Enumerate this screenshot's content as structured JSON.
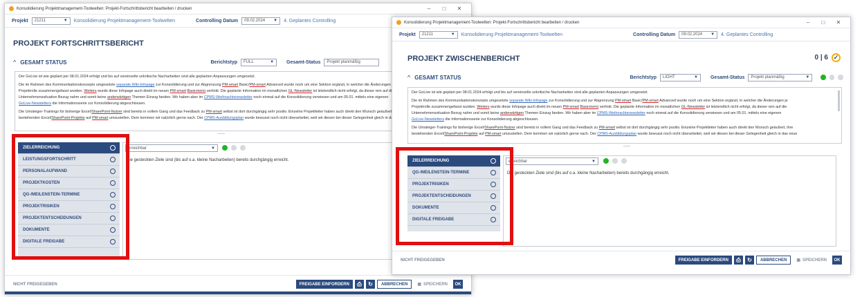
{
  "window_title": "Konsolidierung Projektmanagement-Toolwelten: Projekt-Fortschrittsbericht bearbeiten / drucken",
  "window_title2": "Konsolidierung Projektmanagement-Toolwelten: Projekt-Fortschrittsbericht bearbeiten / drucken",
  "window_controls": {
    "min": "–",
    "max": "□",
    "close": "✕"
  },
  "project": {
    "label": "Projekt",
    "id": "21211",
    "name": "Konsolidierung Projektmanagement-Toolwelten",
    "controlling_label": "Controlling Datum",
    "controlling_date": "09.02.2024",
    "controlling_name": "4. Geplantes Controlling"
  },
  "win1": {
    "report_title": "PROJEKT FORTSCHRITTSBERICHT",
    "section_title": "GESAMT STATUS",
    "berichtstyp_label": "Berichtstyp",
    "berichtstyp_value": "FULL",
    "gesamtstatus_label": "Gesamt-Status",
    "gesamtstatus_value": "Projekt planmäßig",
    "status_select": "erreichbar",
    "status_text": "Die gesteckten Ziele sind (bis auf o.a. kleine Nacharbeiten) bereits durchgängig erreicht.",
    "nav": [
      "ZIELERREICHUNG",
      "LEISTUNGSFORTSCHRITT",
      "PERSONALAUFWAND",
      "PROJEKTKOSTEN",
      "QG-/MEILENSTEIN-TERMINE",
      "PROJEKTRISIKEN",
      "PROJEKTENTSCHEIDUNGEN",
      "DOKUMENTE",
      "DIGITALE FREIGABE"
    ]
  },
  "win2": {
    "report_title": "PROJEKT ZWISCHENBERICHT",
    "score": "0 | 6",
    "section_title": "GESAMT STATUS",
    "berichtstyp_label": "Berichtstyp",
    "berichtstyp_value": "LIGHT",
    "gesamtstatus_label": "Gesamt-Status",
    "gesamtstatus_value": "Projekt planmäßig",
    "status_select": "erreichbar",
    "status_text": "Die gesteckten Ziele sind (bis auf o.a. kleine Nacharbeiten) bereits durchgängig erreicht.",
    "nav": [
      "ZIELERREICHUNG",
      "QG-/MEILENSTEIN-TERMINE",
      "PROJEKTRISIKEN",
      "PROJEKTENTSCHEIDUNGEN",
      "DOKUMENTE",
      "DIGITALE FREIGABE"
    ]
  },
  "text": {
    "p1": "Der GoLive ist wie geplant per 08.01.2024 erfolgt und bis auf vereinzelte unkritische Nacharbeiten sind alle geplanten Anpassungen umgesetzt.",
    "p2a": "Die im Rahmen des Kommunikationskonzepts umgesetzte ",
    "p2_link1": "separate Wiki-Infopage",
    "p2b": " zur Konsolidierung und zur Abgrenzung ",
    "p2_link2": "PM-smart",
    "p2c": " Basic/",
    "p2_link3": "PM-smart",
    "p2d": " Advanced wurde noch um eine Sektion ergänzt, in welcher die Änderungen je",
    "p2e": "Projektrolle zusammengefasst wurden. ",
    "p2_link4": "Weiters",
    "p2f": " wurde diese Infopage auch direkt im neuen ",
    "p2_link5": "PM-smart",
    "p2g": " ",
    "p2_link6": "Basicmenü",
    "p2h": " verlinkt. Die geplante Information im monatlichen ",
    "p2_link7": "GL-Newsletter",
    "p2i": " ist letztendlich nicht erfolgt, da dieser rein auf die",
    "p2j": "Unternehmenssituation Bezug nahm und somit keine ",
    "p2_link8": "anderwärtigen",
    "p2k": " Themen Einzug fanden. Wir haben aber im ",
    "p2_link9": "CPMS-Weihnachtsnewsletter",
    "p2l": " noch einmal auf die Konsolidierung verwiesen und am 05.01. mittels eine eigenen",
    "p2_link10": "GoLive-Newsletters",
    "p2m": " die Informationsserie zur Konsolidierung abgeschlossen.",
    "p3a": "Die Umsteiger-Trainings für bisherige Excel/",
    "p3_link1": "SharePoint-Nutzer",
    "p3b": " sind bereits in vollem Gang und das Feedback zu ",
    "p3_link2": "PM-smart",
    "p3c": " selbst ist dort durchgängig sehr positiv. Einzelne Projektleiter haben auch direkt den Wunsch geäußert, ihre",
    "p3d": "bestehenden Excel/",
    "p3_link3": "SharePoint-Projekte",
    "p3e": " auf ",
    "p3_link4": "PM-smart",
    "p3f": " umzustellen. Dem kommen wir natürlich gerne nach. Der ",
    "p3_link5": "CPMS-Ausbildungsplan",
    "p3g": " wurde bewusst noch nicht überarbeitet, weil wir diesen bei dieser Gelegenheit gleich in das neue"
  },
  "footer": {
    "status": "NICHT FREIGEGEBEN",
    "request": "FREIGABE EINFORDERN",
    "cancel": "ABBRECHEN",
    "save": "SPEICHERN",
    "ok": "OK"
  },
  "colors": {
    "accent": "#2b4a7e",
    "highlight": "#e01010",
    "green": "#22b522"
  }
}
